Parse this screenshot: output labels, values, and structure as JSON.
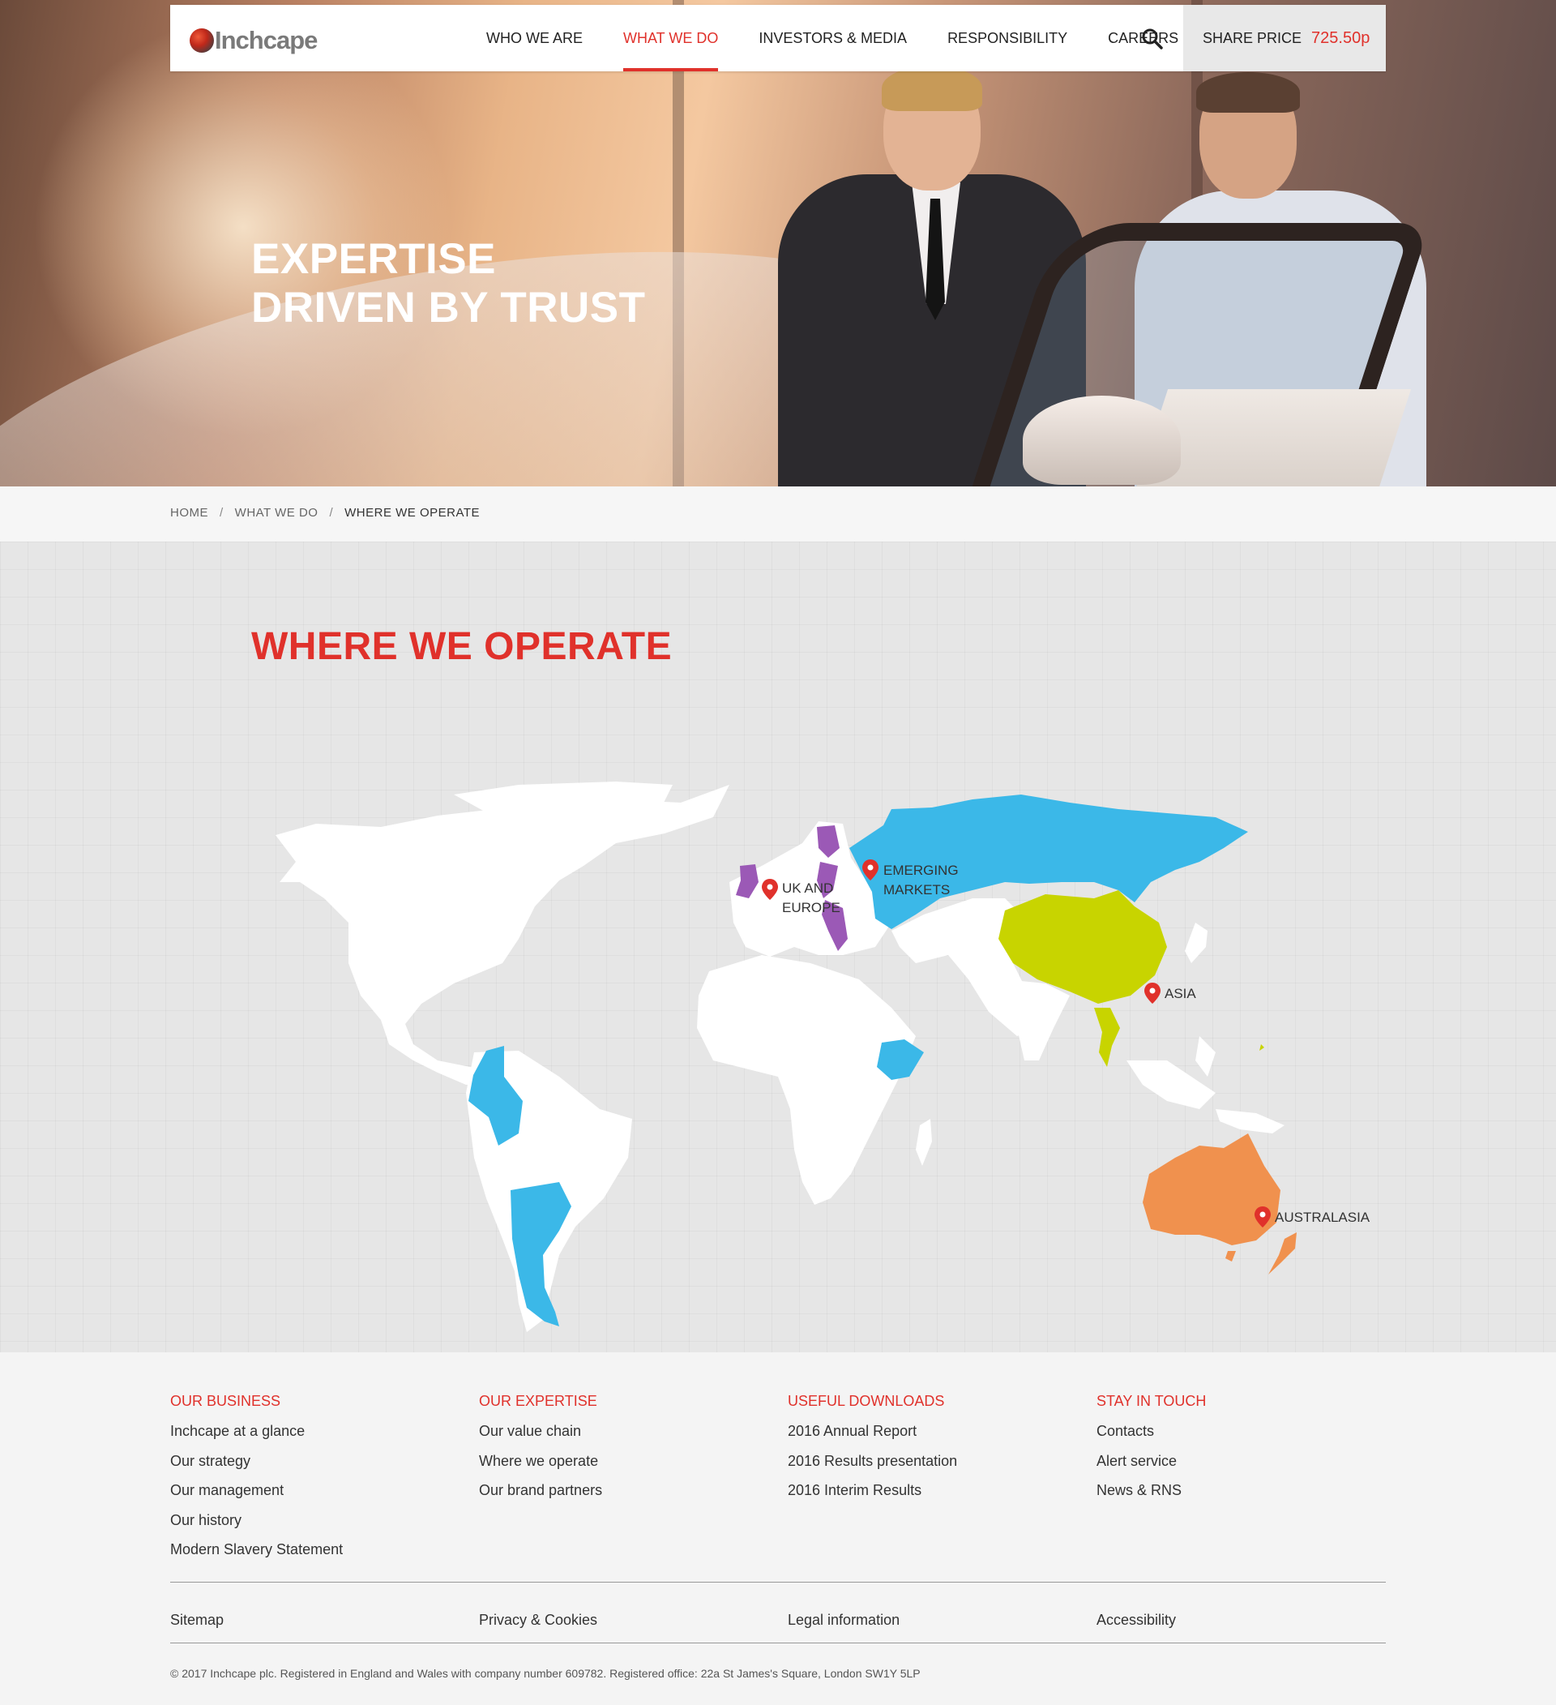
{
  "nav": {
    "logo_text": "Inchcape",
    "items": [
      {
        "label": "WHO WE ARE",
        "active": false
      },
      {
        "label": "WHAT WE DO",
        "active": true
      },
      {
        "label": "INVESTORS & MEDIA",
        "active": false
      },
      {
        "label": "RESPONSIBILITY",
        "active": false
      },
      {
        "label": "CAREERS",
        "active": false
      }
    ],
    "search_icon": "search-icon",
    "share_label": "SHARE PRICE",
    "share_value": "725.50p"
  },
  "hero": {
    "title_line1": "EXPERTISE",
    "title_line2": "DRIVEN BY TRUST"
  },
  "breadcrumb": {
    "items": [
      "HOME",
      "WHAT WE DO",
      "WHERE WE OPERATE"
    ],
    "separator": "/"
  },
  "map": {
    "title": "WHERE WE OPERATE",
    "marker_icon": "map-pin-icon",
    "regions": [
      {
        "label_line1": "UK AND",
        "label_line2": "EUROPE",
        "color": "#9b59b6"
      },
      {
        "label_line1": "EMERGING",
        "label_line2": "MARKETS",
        "color": "#3bb8e8"
      },
      {
        "label_line1": "ASIA",
        "label_line2": "",
        "color": "#c8d400"
      },
      {
        "label_line1": "AUSTRALASIA",
        "label_line2": "",
        "color": "#f0914e"
      }
    ]
  },
  "footer": {
    "columns": [
      {
        "heading": "OUR BUSINESS",
        "links": [
          "Inchcape at a glance",
          "Our strategy",
          "Our management",
          "Our history",
          "Modern Slavery Statement"
        ]
      },
      {
        "heading": "OUR EXPERTISE",
        "links": [
          "Our value chain",
          "Where we operate",
          "Our brand partners"
        ]
      },
      {
        "heading": "USEFUL DOWNLOADS",
        "links": [
          "2016 Annual Report",
          "2016 Results presentation",
          "2016 Interim Results"
        ]
      },
      {
        "heading": "STAY IN TOUCH",
        "links": [
          "Contacts",
          "Alert service",
          "News & RNS"
        ]
      }
    ],
    "bottom_links": [
      "Sitemap",
      "Privacy & Cookies",
      "Legal information",
      "Accessibility"
    ],
    "copyright": "© 2017 Inchcape plc. Registered in England and Wales with company number 609782. Registered office: 22a St James's Square, London SW1Y 5LP"
  },
  "colors": {
    "accent": "#e0312b",
    "emerging": "#3bb8e8",
    "europe": "#9b59b6",
    "asia": "#c8d400",
    "australasia": "#f0914e"
  }
}
